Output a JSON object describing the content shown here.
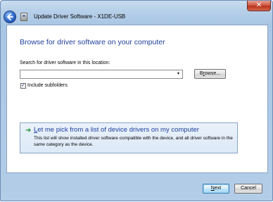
{
  "window": {
    "title": "Update Driver Software - X1DE-USB",
    "close_glyph": "✕"
  },
  "main": {
    "heading": "Browse for driver software on your computer",
    "search_label": "Search for driver software in this location:",
    "path_value": "",
    "dropdown_glyph": "▾",
    "browse_label_prefix": "B",
    "browse_label_accel": "r",
    "browse_label_rest": "owse...",
    "include_subfolders": {
      "checked": true,
      "check_glyph": "✓",
      "label": "Include subfolders"
    },
    "option": {
      "arrow_glyph": "➔",
      "title_accel": "L",
      "title_rest": "et me pick from a list of device drivers on my computer",
      "description": "This list will show installed driver software compatible with the device, and all driver software in the same category as the device."
    }
  },
  "footer": {
    "next_label_accel": "N",
    "next_label_rest": "ext",
    "cancel_label": "Cancel"
  },
  "icons": {
    "back": "back-arrow-icon",
    "app": "device-manager-icon",
    "close": "close-icon",
    "option": "green-arrow-icon"
  }
}
